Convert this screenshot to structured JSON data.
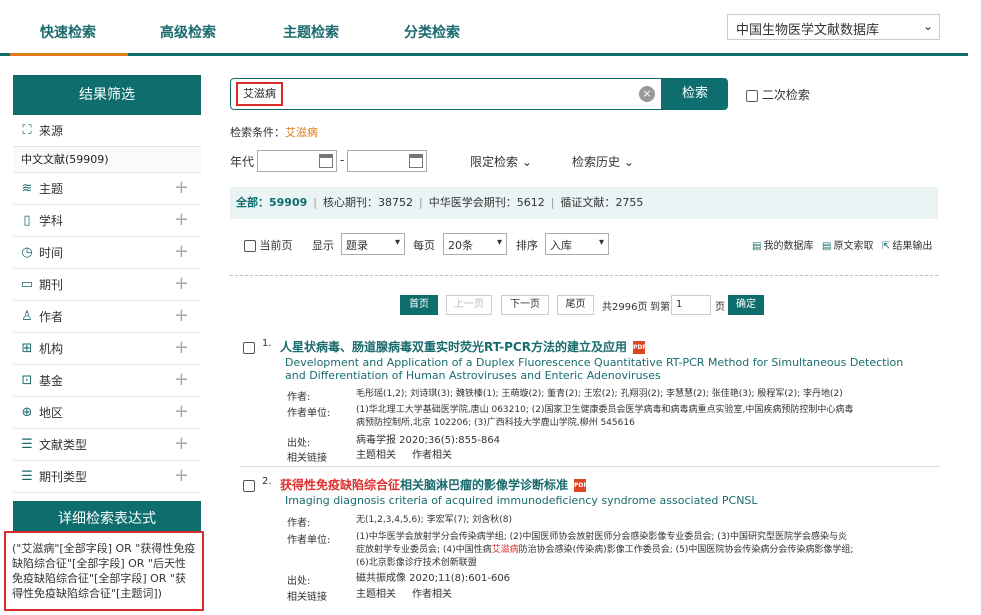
{
  "nav": {
    "tabs": [
      "快速检索",
      "高级检索",
      "主题检索",
      "分类检索"
    ],
    "database": "中国生物医学文献数据库"
  },
  "sidebar": {
    "title": "结果筛选",
    "source_label": "来源",
    "source_value": "中文文献(59909)",
    "items": [
      "主题",
      "学科",
      "时间",
      "期刊",
      "作者",
      "机构",
      "基金",
      "地区",
      "文献类型",
      "期刊类型"
    ],
    "expr_title": "详细检索表达式",
    "expression": "(\"艾滋病\"[全部字段] OR \"获得性免疫缺陷综合征\"[全部字段] OR \"后天性免疫缺陷综合征\"[全部字段] OR \"获得性免疫缺陷综合征\"[主题词])"
  },
  "search": {
    "term": "艾滋病",
    "button": "检索",
    "secondary": "二次检索",
    "cond_label": "检索条件：",
    "cond_value": "艾滋病"
  },
  "filters": {
    "year_label": "年代",
    "dash": "-",
    "limit": "限定检索",
    "history": "检索历史"
  },
  "summary": {
    "all_label": "全部：",
    "all_count": "59909",
    "core_label": "核心期刊：",
    "core_count": "38752",
    "cma_label": "中华医学会期刊：",
    "cma_count": "5612",
    "evidence_label": "循证文献：",
    "evidence_count": "2755"
  },
  "controls": {
    "current_page": "当前页",
    "display_label": "显示",
    "display_value": "题录",
    "per_page_label": "每页",
    "per_page_value": "20条",
    "sort_label": "排序",
    "sort_value": "入库",
    "my_db": "我的数据库",
    "fulltext": "原文索取",
    "export": "结果输出"
  },
  "pager": {
    "first": "首页",
    "prev": "上一页",
    "next": "下一页",
    "last": "尾页",
    "total": "共2996页",
    "goto_label": "到第",
    "goto_value": "1",
    "page_unit": "页",
    "confirm": "确定"
  },
  "results": [
    {
      "num": "1.",
      "title": "人星状病毒、肠道腺病毒双重实时荧光RT-PCR方法的建立及应用",
      "title_hl": "",
      "title_rest": "",
      "en": "Development and Application of a Duplex Fluorescence Quantitative RT-PCR Method for Simultaneous Detection and Differentiation of Human Astroviruses and Enteric Adenoviruses",
      "author_label": "作者:",
      "authors": "毛彤瑶(1,2); 刘诗琪(3); 魏铁榛(1); 王萌璇(2); 董青(2); 王宏(2); 孔翔羽(2); 李慧慧(2); 张佳艳(3); 殷程军(2); 李丹地(2)",
      "inst_label": "作者单位:",
      "inst_a": "(1)华北理工大学基础医学院,唐山 063210; (2)国家卫生健康委员会医学病毒和病毒病重点实验室,中国疾病预防控制中心病毒病预防控制所,北京 102206; (3)广西科技大学鹿山学院,柳州 545616",
      "inst_hl": "",
      "inst_b": "",
      "source_label": "出处:",
      "source": "病毒学报 2020;36(5):855-864",
      "links_label": "相关链接",
      "link1": "主题相关",
      "link2": "作者相关"
    },
    {
      "num": "2.",
      "title": "",
      "title_hl": "获得性免疫缺陷综合征",
      "title_rest": "相关脑淋巴瘤的影像学诊断标准",
      "en": "Imaging diagnosis criteria of acquired immunodeficiency syndrome associated PCNSL",
      "author_label": "作者:",
      "authors": "无(1,2,3,4,5,6); 李宏军(7); 刘含秋(8)",
      "inst_label": "作者单位:",
      "inst_a": "(1)中华医学会放射学分会传染病学组; (2)中国医师协会放射医师分会感染影像专业委员会; (3)中国研究型医院学会感染与炎症放射学专业委员会; (4)中国性病",
      "inst_hl": "艾滋病",
      "inst_b": "防治协会感染(传染病)影像工作委员会; (5)中国医院协会传染病分会传染病影像学组; (6)北京影像诊疗技术创新联盟",
      "source_label": "出处:",
      "source": "磁共振成像 2020;11(8):601-606",
      "links_label": "相关链接",
      "link1": "主题相关",
      "link2": "作者相关"
    }
  ]
}
